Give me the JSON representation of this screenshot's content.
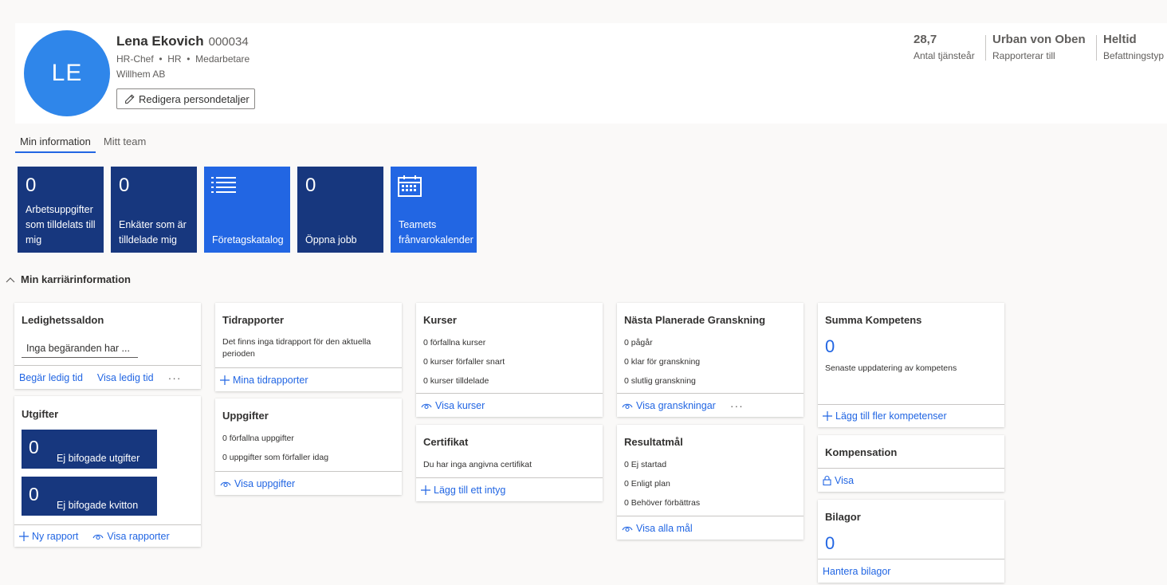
{
  "profile": {
    "initials": "LE",
    "name": "Lena Ekovich",
    "id": "000034",
    "title": "HR-Chef",
    "department": "HR",
    "role": "Medarbetare",
    "company": "Willhem AB",
    "edit_label": "Redigera persondetaljer",
    "avatar_color": "#2f86ea"
  },
  "stats": [
    {
      "value": "28,7",
      "label": "Antal tjänsteår"
    },
    {
      "value": "Urban von Oben",
      "label": "Rapporterar till"
    },
    {
      "value": "Heltid",
      "label": "Befattningstyp"
    }
  ],
  "tabs": [
    {
      "label": "Min information",
      "active": true
    },
    {
      "label": "Mitt team",
      "active": false
    }
  ],
  "tiles": [
    {
      "count": "0",
      "label": "Arbetsuppgifter som tilldelats till mig",
      "style": "dark"
    },
    {
      "count": "0",
      "label": "Enkäter som är tilldelade mig",
      "style": "dark"
    },
    {
      "icon": "list-icon",
      "label": "Företagskatalog",
      "style": "light"
    },
    {
      "count": "0",
      "label": "Öppna jobb",
      "style": "dark"
    },
    {
      "icon": "calendar-icon",
      "label": "Teamets frånvarokalender",
      "style": "light"
    }
  ],
  "section": {
    "title": "Min karriärinformation"
  },
  "cards": {
    "leave": {
      "title": "Ledighetssaldon",
      "input_value": "Inga begäranden har ...",
      "action1": "Begär ledig tid",
      "action2": "Visa ledig tid"
    },
    "expenses": {
      "title": "Utgifter",
      "tile1_count": "0",
      "tile1_label": "Ej bifogade utgifter",
      "tile2_count": "0",
      "tile2_label": "Ej bifogade kvitton",
      "action1": "Ny rapport",
      "action2": "Visa rapporter"
    },
    "timesheets": {
      "title": "Tidrapporter",
      "text": "Det finns inga tidrapport för den aktuella perioden",
      "action": "Mina tidrapporter"
    },
    "tasks": {
      "title": "Uppgifter",
      "line1": "0 förfallna uppgifter",
      "line2": "0 uppgifter som förfaller idag",
      "action": "Visa uppgifter"
    },
    "courses": {
      "title": "Kurser",
      "line1": "0 förfallna kurser",
      "line2": "0 kurser förfaller snart",
      "line3": "0 kurser tilldelade",
      "action": "Visa kurser"
    },
    "certificates": {
      "title": "Certifikat",
      "text": "Du har inga angivna certifikat",
      "action": "Lägg till ett intyg"
    },
    "review": {
      "title": "Nästa Planerade Granskning",
      "line1": "0 pågår",
      "line2": "0 klar för granskning",
      "line3": "0 slutlig granskning",
      "action": "Visa granskningar"
    },
    "goals": {
      "title": "Resultatmål",
      "line1": "0 Ej startad",
      "line2": "0 Enligt plan",
      "line3": "0 Behöver förbättras",
      "action": "Visa alla mål"
    },
    "skills": {
      "title": "Summa Kompetens",
      "count": "0",
      "text": "Senaste uppdatering av kompetens",
      "action": "Lägg till fler kompetenser"
    },
    "compensation": {
      "title": "Kompensation",
      "action": "Visa"
    },
    "attachments": {
      "title": "Bilagor",
      "count": "0",
      "action": "Hantera bilagor"
    }
  },
  "colors": {
    "accent": "#2266e3",
    "tile_dark": "#17377e",
    "tile_light": "#2266e3"
  }
}
